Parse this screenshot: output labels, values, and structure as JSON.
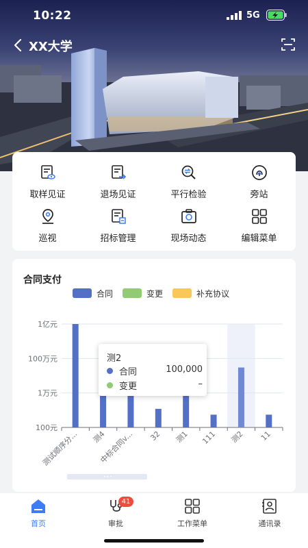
{
  "status_bar": {
    "time": "10:22",
    "network": "5G",
    "icons": [
      "signal-icon",
      "battery-charging-icon"
    ]
  },
  "header": {
    "title": "XX大学",
    "icons": [
      "back-arrow-icon",
      "scan-icon"
    ]
  },
  "menu": [
    {
      "label": "取样见证",
      "icon": "sample-witness-icon"
    },
    {
      "label": "退场见证",
      "icon": "exit-witness-icon"
    },
    {
      "label": "平行检验",
      "icon": "parallel-inspection-icon"
    },
    {
      "label": "旁站",
      "icon": "side-station-icon"
    },
    {
      "label": "巡视",
      "icon": "patrol-location-icon"
    },
    {
      "label": "招标管理",
      "icon": "bidding-management-icon"
    },
    {
      "label": "现场动态",
      "icon": "site-camera-icon"
    },
    {
      "label": "编辑菜单",
      "icon": "edit-menu-grid-icon"
    }
  ],
  "chart_section": {
    "title": "合同支付",
    "tooltip": {
      "title": "测2",
      "rows": [
        {
          "name": "合同",
          "value": "100,000"
        },
        {
          "name": "变更",
          "value": "–"
        }
      ]
    }
  },
  "chart_data": {
    "type": "bar",
    "scale": "log",
    "categories": [
      "测试顺序分...",
      "测4",
      "中标合同v...",
      "32",
      "测1",
      "111",
      "测2",
      "11"
    ],
    "series": [
      {
        "name": "合同",
        "color": "#5470c6",
        "values": [
          100000000,
          200000,
          30000,
          1200,
          20000,
          550,
          300000,
          550
        ]
      },
      {
        "name": "变更",
        "color": "#91cc75",
        "values": []
      },
      {
        "name": "补充协议",
        "color": "#fac858",
        "values": []
      }
    ],
    "y_ticks": [
      "100元",
      "1万元",
      "100万元",
      "1亿元"
    ],
    "ylim": [
      100,
      100000000
    ],
    "highlighted_category": "测2",
    "grid": true,
    "legend_position": "top"
  },
  "tabbar": [
    {
      "label": "首页",
      "icon": "home-icon",
      "active": true,
      "badge": ""
    },
    {
      "label": "审批",
      "icon": "approval-stethoscope-icon",
      "active": false,
      "badge": "41"
    },
    {
      "label": "工作菜单",
      "icon": "work-menu-grid-icon",
      "active": false,
      "badge": ""
    },
    {
      "label": "通讯录",
      "icon": "contacts-icon",
      "active": false,
      "badge": ""
    }
  ],
  "colors": {
    "accent": "#3e7cf7",
    "bar": "#5470c6",
    "badge": "#f24a3e"
  }
}
